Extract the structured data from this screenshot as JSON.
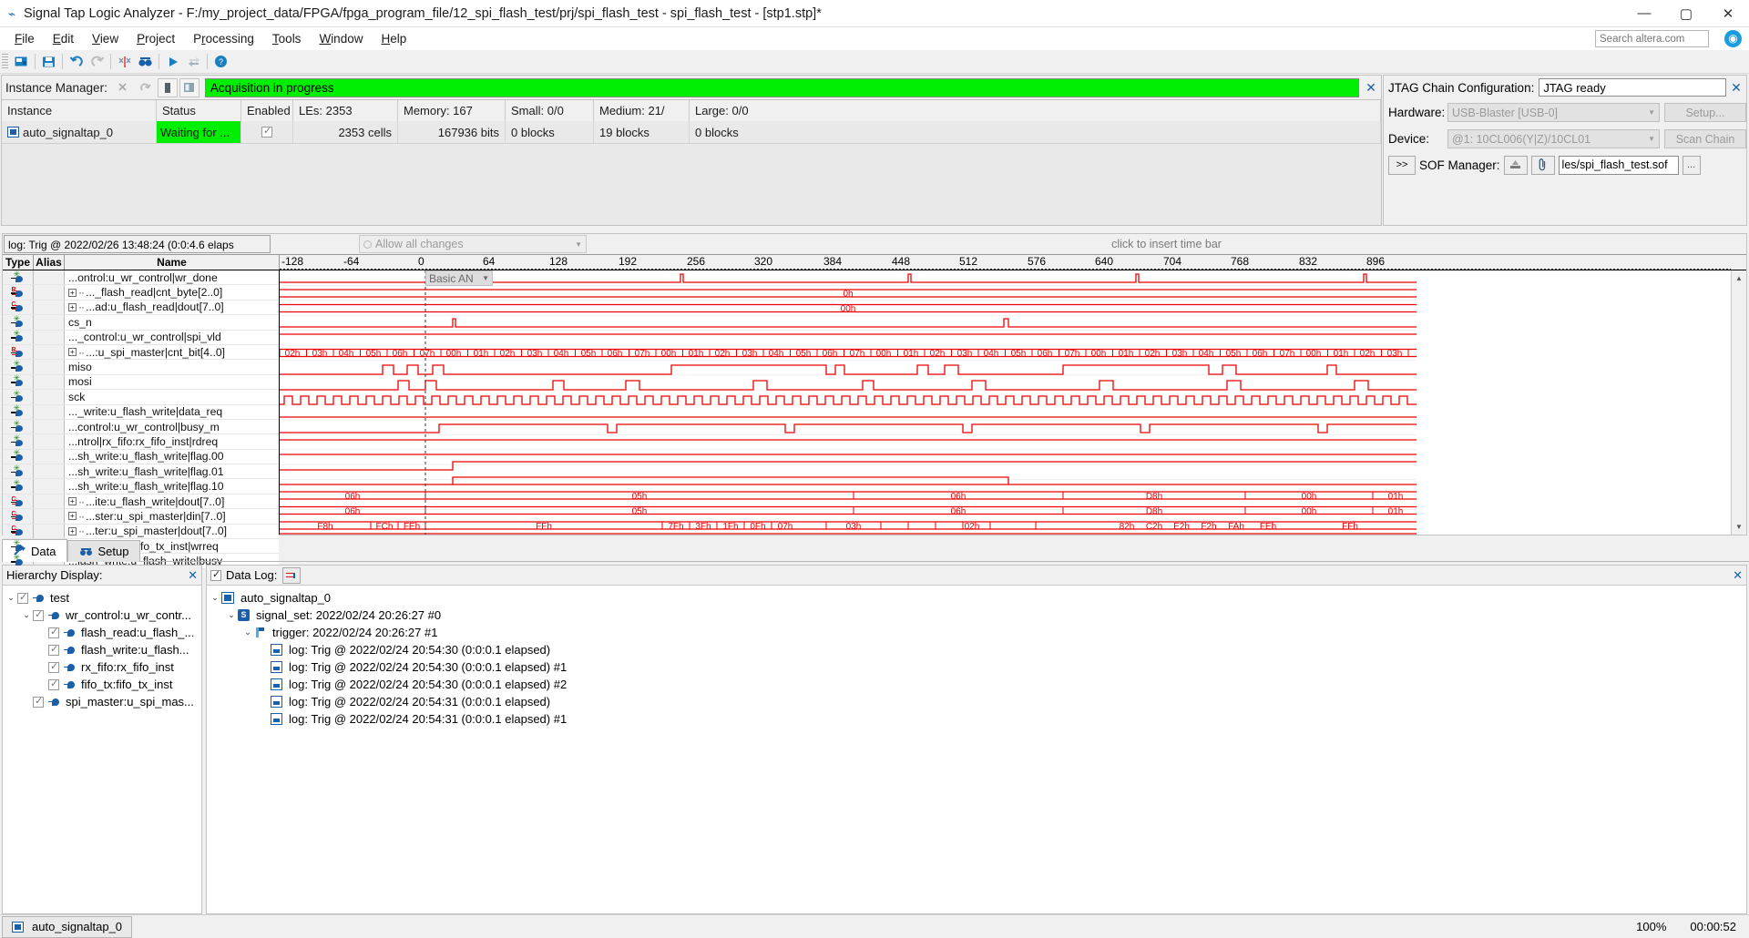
{
  "window": {
    "title": "Signal Tap Logic Analyzer - F:/my_project_data/FPGA/fpga_program_file/12_spi_flash_test/prj/spi_flash_test - spi_flash_test - [stp1.stp]*",
    "minimize": "—",
    "maximize": "▢",
    "close": "✕"
  },
  "menu": {
    "items": [
      "File",
      "Edit",
      "View",
      "Project",
      "Processing",
      "Tools",
      "Window",
      "Help"
    ],
    "search_placeholder": "Search altera.com",
    "globe_icon": "◉"
  },
  "toolbar": {
    "buttons": [
      {
        "name": "open-file-icon",
        "glyph": "▤"
      },
      {
        "name": "save-icon",
        "glyph": "▣"
      },
      {
        "name": "undo-icon",
        "glyph": "↶"
      },
      {
        "name": "redo-icon",
        "glyph": "↷"
      },
      {
        "name": "cut-waveform-icon",
        "glyph": "✂"
      },
      {
        "name": "find-icon",
        "glyph": "👓"
      },
      {
        "name": "run-analysis-icon",
        "glyph": "▶"
      },
      {
        "name": "stop-analysis-icon",
        "glyph": "⬗"
      },
      {
        "name": "help-icon",
        "glyph": "?"
      }
    ]
  },
  "instance_manager": {
    "title": "Instance Manager:",
    "status_banner": "Acquisition in progress",
    "close_icon": "✕",
    "buttons": [
      {
        "name": "run-analysis-button",
        "glyph": "⤬"
      },
      {
        "name": "autorun-analysis-button",
        "glyph": "↻"
      },
      {
        "name": "stop-analysis-button",
        "glyph": "▮"
      },
      {
        "name": "read-data-button",
        "glyph": "▤"
      }
    ],
    "columns": [
      "Instance",
      "Status",
      "Enabled",
      "LEs: 2353",
      "Memory: 167",
      "Small: 0/0",
      "Medium: 21/",
      "Large: 0/0"
    ],
    "rows": [
      {
        "instance": "auto_signaltap_0",
        "status": "Waiting for ...",
        "enabled": true,
        "les": "2353 cells",
        "memory": "167936 bits",
        "small": "0 blocks",
        "medium": "19 blocks",
        "large": "0 blocks"
      }
    ]
  },
  "jtag": {
    "title": "JTAG Chain Configuration:",
    "ready": "JTAG ready",
    "close_icon": "✕",
    "hardware_label": "Hardware:",
    "hardware_value": "USB-Blaster [USB-0]",
    "setup_button": "Setup...",
    "device_label": "Device:",
    "device_value": "@1: 10CL006(Y|Z)/10CL01",
    "scan_chain_button": "Scan Chain",
    "expand_button": ">>",
    "sof_label": "SOF Manager:",
    "sof_file": "les/spi_flash_test.sof",
    "sof_browse": "...",
    "sof_program_icon": "⛃",
    "sof_attach_icon": "📎"
  },
  "waveform": {
    "log_field": "log: Trig @ 2022/02/26 13:48:24 (0:0:4.6 elaps",
    "allow_all_changes": "Allow all changes",
    "click_to_insert": "click to insert time bar",
    "basic_an": "Basic AN",
    "columns": [
      "Type",
      "Alias",
      "Name"
    ],
    "ruler_ticks": [
      "-128",
      "-64",
      "0",
      "64",
      "128",
      "192",
      "256",
      "320",
      "384",
      "448",
      "512",
      "576",
      "640",
      "704",
      "768",
      "832",
      "896"
    ],
    "signals": [
      {
        "type": "star",
        "name": "...ontrol:u_wr_control|wr_done",
        "expandable": false
      },
      {
        "type": "bus-r",
        "name": "..._flash_read|cnt_byte[2..0]",
        "expandable": true
      },
      {
        "type": "bus-c",
        "name": "...ad:u_flash_read|dout[7..0]",
        "expandable": true
      },
      {
        "type": "star",
        "name": "cs_n",
        "expandable": false
      },
      {
        "type": "star",
        "name": "..._control:u_wr_control|spi_vld",
        "expandable": false
      },
      {
        "type": "bus-r",
        "name": "...:u_spi_master|cnt_bit[4..0]",
        "expandable": true
      },
      {
        "type": "star",
        "name": "miso",
        "expandable": false
      },
      {
        "type": "star",
        "name": "mosi",
        "expandable": false
      },
      {
        "type": "star",
        "name": "sck",
        "expandable": false
      },
      {
        "type": "star",
        "name": "..._write:u_flash_write|data_req",
        "expandable": false
      },
      {
        "type": "star",
        "name": "...control:u_wr_control|busy_m",
        "expandable": false
      },
      {
        "type": "star",
        "name": "...ntrol|rx_fifo:rx_fifo_inst|rdreq",
        "expandable": false
      },
      {
        "type": "star",
        "name": "...sh_write:u_flash_write|flag.00",
        "expandable": false
      },
      {
        "type": "star",
        "name": "...sh_write:u_flash_write|flag.01",
        "expandable": false
      },
      {
        "type": "star",
        "name": "...sh_write:u_flash_write|flag.10",
        "expandable": false
      },
      {
        "type": "bus-c",
        "name": "...ite:u_flash_write|dout[7..0]",
        "expandable": true
      },
      {
        "type": "bus-c",
        "name": "...ster:u_spi_master|din[7..0]",
        "expandable": true
      },
      {
        "type": "bus-c",
        "name": "...ter:u_spi_master|dout[7..0]",
        "expandable": true
      },
      {
        "type": "star",
        "name": "...ntrol|fifo_tx:fifo_tx_inst|wrreq",
        "expandable": false
      },
      {
        "type": "star",
        "name": "...lash_write:u_flash_write|busy",
        "expandable": false
      }
    ],
    "bus_labels": {
      "cnt_byte": [
        "0h"
      ],
      "flash_read_dout": [
        "00h"
      ],
      "cnt_bit": [
        "02h",
        "03h",
        "04h",
        "05h",
        "06h",
        "07h",
        "00h",
        "01h",
        "02h",
        "03h",
        "04h",
        "05h",
        "06h",
        "07h",
        "00h",
        "01h",
        "02h",
        "03h",
        "04h",
        "05h",
        "06h",
        "07h",
        "00h",
        "01h",
        "02h",
        "03h",
        "04h",
        "05h",
        "06h",
        "07h",
        "00h",
        "01h",
        "02h",
        "03h",
        "04h",
        "05h",
        "06h",
        "07h",
        "00h",
        "01h",
        "02h",
        "03h"
      ],
      "flash_write_dout": [
        "06h",
        "05h",
        "06h",
        "D8h",
        "00h",
        "01h"
      ],
      "spi_master_din": [
        "06h",
        "05h",
        "06h",
        "D8h",
        "00h",
        "01h"
      ],
      "spi_master_dout": [
        "F8h",
        "FCh",
        "FEh",
        "FFh",
        "7Fh",
        "3Fh",
        "1Fh",
        "0Fh",
        "07h",
        "03h",
        "02h",
        "82h",
        "C2h",
        "E2h",
        "F2h",
        "FAh",
        "FEh",
        "FFh"
      ]
    }
  },
  "tabs": {
    "data": "Data",
    "setup": "Setup"
  },
  "hierarchy": {
    "title": "Hierarchy Display:",
    "close_icon": "✕",
    "nodes": [
      {
        "label": "test",
        "depth": 0,
        "expanded": true,
        "checked": true
      },
      {
        "label": "wr_control:u_wr_contr...",
        "depth": 1,
        "expanded": true,
        "checked": true
      },
      {
        "label": "flash_read:u_flash_...",
        "depth": 2,
        "expanded": null,
        "checked": true
      },
      {
        "label": "flash_write:u_flash...",
        "depth": 2,
        "expanded": null,
        "checked": true
      },
      {
        "label": "rx_fifo:rx_fifo_inst",
        "depth": 2,
        "expanded": null,
        "checked": true
      },
      {
        "label": "fifo_tx:fifo_tx_inst",
        "depth": 2,
        "expanded": null,
        "checked": true
      },
      {
        "label": "spi_master:u_spi_mas...",
        "depth": 1,
        "expanded": null,
        "checked": true
      }
    ]
  },
  "data_log": {
    "title": "Data Log:",
    "checked": true,
    "close_icon": "✕",
    "nodes": [
      {
        "label": "auto_signaltap_0",
        "depth": 0,
        "icon": "instance-icon",
        "expanded": true
      },
      {
        "label": "signal_set: 2022/02/24 20:26:27  #0",
        "depth": 1,
        "icon": "signalset-icon",
        "expanded": true
      },
      {
        "label": "trigger: 2022/02/24 20:26:27  #1",
        "depth": 2,
        "icon": "trigger-icon",
        "expanded": true
      },
      {
        "label": "log: Trig @ 2022/02/24 20:54:30 (0:0:0.1 elapsed)",
        "depth": 3,
        "icon": "log-icon",
        "expanded": null
      },
      {
        "label": "log: Trig @ 2022/02/24 20:54:30 (0:0:0.1 elapsed) #1",
        "depth": 3,
        "icon": "log-icon",
        "expanded": null
      },
      {
        "label": "log: Trig @ 2022/02/24 20:54:30 (0:0:0.1 elapsed) #2",
        "depth": 3,
        "icon": "log-icon",
        "expanded": null
      },
      {
        "label": "log: Trig @ 2022/02/24 20:54:31 (0:0:0.1 elapsed)",
        "depth": 3,
        "icon": "log-icon",
        "expanded": null
      },
      {
        "label": "log: Trig @ 2022/02/24 20:54:31 (0:0:0.1 elapsed) #1",
        "depth": 3,
        "icon": "log-icon",
        "expanded": null
      }
    ]
  },
  "statusbar": {
    "instance_tab": "auto_signaltap_0",
    "zoom": "100%",
    "elapsed": "00:00:52"
  },
  "colors": {
    "waveform": "#ee0000",
    "accent": "#1a5fa8",
    "status_green": "#00ee00"
  }
}
